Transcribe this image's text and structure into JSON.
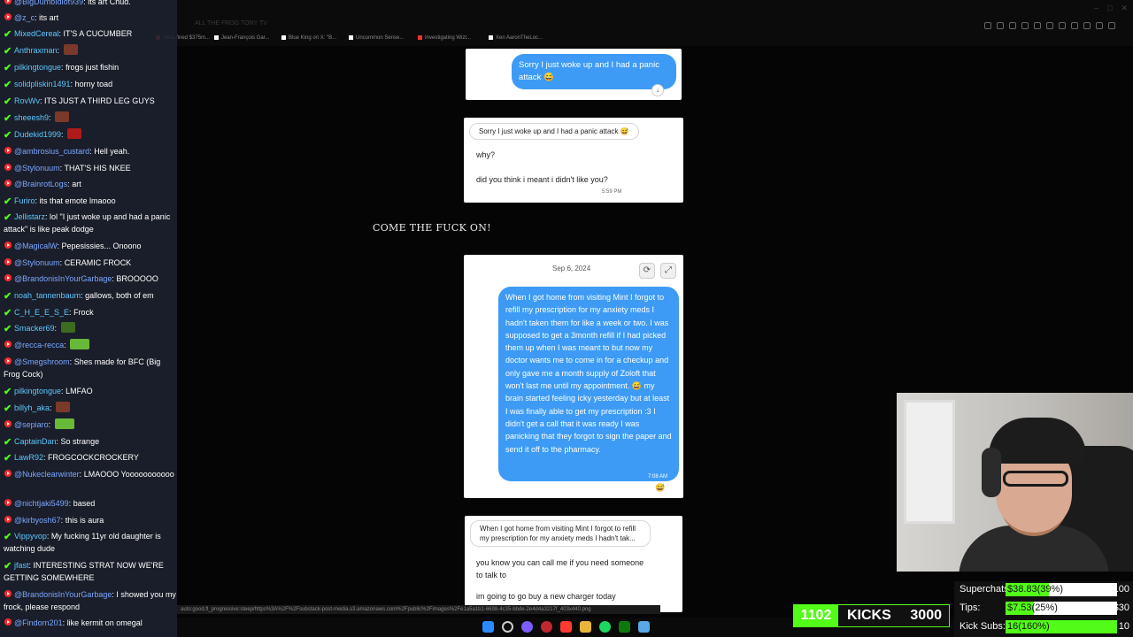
{
  "browser": {
    "url": "ALL THE FROG TONY TV",
    "bookmarks": [
      "Meta fined $375m...",
      "Jean-François Gar...",
      "Blue King on X: \"B...",
      "Uncommon Sense...",
      "Investigating Wizt...",
      "Xen AaronTheLoc..."
    ],
    "status_url": "auto:good,fl_progressive:steep/https%3A%2F%2Fsubstack-post-media.s3.amazonaws.com%2Fpublic%2Fimages%2Fe1a5a1b1-6698-4c35-bbde-2e4d4a3217f_403x440.png"
  },
  "chat": {
    "messages": [
      {
        "badge": "yt",
        "user": "@BigDumbIdiot939",
        "user_color": "#7aa7ff",
        "text": "its art Chud."
      },
      {
        "badge": "yt",
        "user": "@z_c",
        "user_color": "#7aa7ff",
        "text": "its art"
      },
      {
        "badge": "kick",
        "user": "MixedCereal",
        "user_color": "#5ec8ff",
        "text": "IT'S A CUCUMBER"
      },
      {
        "badge": "kick",
        "user": "Anthraxman",
        "user_color": "#5ec8ff",
        "text": "",
        "emote": "box"
      },
      {
        "badge": "kick",
        "user": "pilkingtongue",
        "user_color": "#5ec8ff",
        "text": "frogs just fishin"
      },
      {
        "badge": "kick",
        "user": "solidpliskin1491",
        "user_color": "#5ec8ff",
        "text": "horny toad"
      },
      {
        "badge": "kick",
        "user": "RovWv",
        "user_color": "#5ec8ff",
        "text": "ITS JUST A THIRD LEG GUYS"
      },
      {
        "badge": "kick",
        "user": "sheeesh9",
        "user_color": "#5ec8ff",
        "text": "",
        "emote": "box"
      },
      {
        "badge": "kick",
        "user": "Dudekid1999",
        "user_color": "#5ec8ff",
        "text": "",
        "emote": "devil"
      },
      {
        "badge": "yt",
        "user": "@ambrosius_custard",
        "user_color": "#7aa7ff",
        "text": "Hell yeah."
      },
      {
        "badge": "yt",
        "user": "@Stylonuum",
        "user_color": "#7aa7ff",
        "text": "THAT'S HIS NKEE"
      },
      {
        "badge": "yt",
        "user": "@BrainrotLogs",
        "user_color": "#7aa7ff",
        "text": "art"
      },
      {
        "badge": "kick",
        "user": "Furiro",
        "user_color": "#5ec8ff",
        "text": "its that emote lmaooo"
      },
      {
        "badge": "kick",
        "user": "Jellistarz",
        "user_color": "#5ec8ff",
        "text": "lol \"I just woke up and had a panic attack\" is like peak dodge"
      },
      {
        "badge": "yt",
        "user": "@MagicalW",
        "user_color": "#7aa7ff",
        "text": "Pepesissies... Onoono"
      },
      {
        "badge": "yt",
        "user": "@Stylonuum",
        "user_color": "#7aa7ff",
        "text": "CERAMIC FROCK"
      },
      {
        "badge": "yt",
        "user": "@BrandonisInYourGarbage",
        "user_color": "#7aa7ff",
        "text": "BROOOOO"
      },
      {
        "badge": "kick",
        "user": "noah_tannenbaum",
        "user_color": "#5ec8ff",
        "text": "gallows, both of em"
      },
      {
        "badge": "kick",
        "user": "C_H_E_E_S_E",
        "user_color": "#5ec8ff",
        "text": "Frock"
      },
      {
        "badge": "kick",
        "user": "Smacker69",
        "user_color": "#5ec8ff",
        "text": "",
        "emote": "plant"
      },
      {
        "badge": "yt",
        "user": "@recca-recca",
        "user_color": "#7aa7ff",
        "text": "",
        "emote": "frog2"
      },
      {
        "badge": "yt",
        "user": "@Smegshroom",
        "user_color": "#7aa7ff",
        "text": "Shes made for BFC (Big Frog Cock)"
      },
      {
        "badge": "kick",
        "user": "pilkingtongue",
        "user_color": "#5ec8ff",
        "text": "LMFAO"
      },
      {
        "badge": "kick",
        "user": "billyh_aka",
        "user_color": "#5ec8ff",
        "text": "",
        "emote": "box"
      },
      {
        "badge": "yt",
        "user": "@sepiaro",
        "user_color": "#7aa7ff",
        "text": "",
        "emote": "frog2"
      },
      {
        "badge": "kick",
        "user": "CaptainDan",
        "user_color": "#5ec8ff",
        "text": "So strange"
      },
      {
        "badge": "kick",
        "user": "LawR92",
        "user_color": "#5ec8ff",
        "text": "FROGCOCKCROCKERY"
      },
      {
        "badge": "yt",
        "user": "@Nukeclearwinter",
        "user_color": "#7aa7ff",
        "text": "LMAOOO Yooooooooooo"
      },
      {
        "badge": "yt",
        "user": "@nichtjaki5499",
        "user_color": "#7aa7ff",
        "text": "based"
      },
      {
        "badge": "yt",
        "user": "@kirbyosh67",
        "user_color": "#7aa7ff",
        "text": "this is aura"
      },
      {
        "badge": "kick",
        "user": "Vippyvop",
        "user_color": "#5ec8ff",
        "text": "My fucking 11yr old daughter is watching dude"
      },
      {
        "badge": "kick",
        "user": "jfast",
        "user_color": "#5ec8ff",
        "text": "INTERESTING STRAT NOW WE'RE GETTING SOMEWHERE"
      },
      {
        "badge": "yt",
        "user": "@BrandonisInYourGarbage",
        "user_color": "#7aa7ff",
        "text": "I showed you my frock, please respond"
      },
      {
        "badge": "yt",
        "user": "@Findorn201",
        "user_color": "#7aa7ff",
        "text": "like kermit on omegal"
      }
    ]
  },
  "post": {
    "card1": {
      "bubble": "Sorry I just woke up and I had a panic attack 😅"
    },
    "card2": {
      "reply_preview": "Sorry I just woke up and I had a panic attack 😅",
      "line1": "why?",
      "line2": "did you think i meant i didn't like you?",
      "time": "5:59 PM"
    },
    "caption": "COME THE FUCK ON!",
    "card3": {
      "date": "Sep 6, 2024",
      "bubble": "When I got home from visiting Mint I forgot to refill my prescription for my anxiety meds I hadn't taken them for like a week or two. I was supposed to get a 3month refill if I had picked them up when I was meant to but now my doctor wants me to come in for a checkup and only gave me a month supply of Zoloft that won't last me until my appointment. 😅 my brain started feeling icky yesterday but at least I was finally able to get my prescription :3 I didn't get a call that it was ready I was panicking that they forgot to sign the paper and send it off to the pharmacy.",
      "time": "7:08 AM"
    },
    "card4": {
      "reply_preview": "When I got home from visiting Mint I forgot to refill my prescription for my anxiety meds I hadn't tak...",
      "line1": "you know you can call me if you need someone to talk to",
      "line2": "im going to go buy a new charger today"
    }
  },
  "overlay": {
    "kicks": {
      "current": "1102",
      "label": "KICKS",
      "goal": "3000"
    },
    "goals": [
      {
        "label": "Superchats:",
        "value": "$38.83(39%)",
        "target": "$100",
        "progress": 0.39
      },
      {
        "label": "Tips:",
        "value": "$7.53(25%)",
        "target": "$30",
        "progress": 0.25
      },
      {
        "label": "Kick Subs:",
        "value": "16(160%)",
        "target": "10",
        "progress": 1.0
      }
    ]
  },
  "colors": {
    "kick_green": "#53fc18",
    "yt_red": "#ff2a2a",
    "imessage_blue": "#3d9bf5"
  }
}
